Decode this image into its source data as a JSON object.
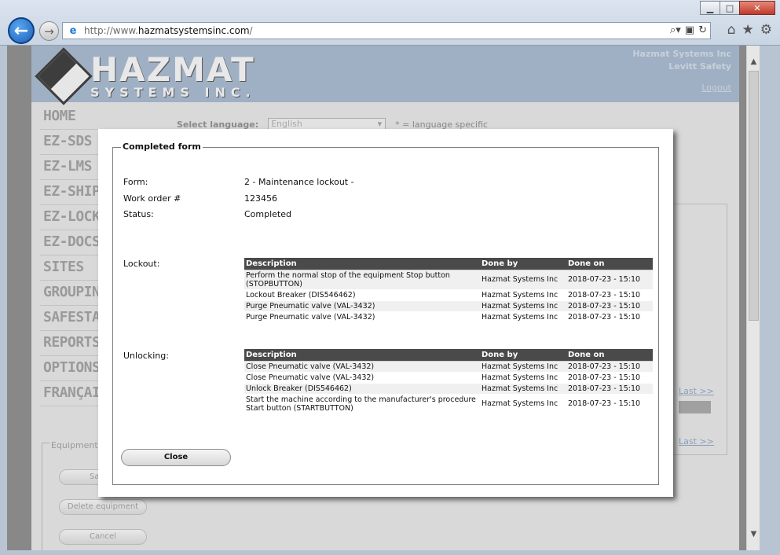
{
  "browser": {
    "url_prefix": "http://www.",
    "url_host": "hazmatsystemsinc.com",
    "url_suffix": "/"
  },
  "site": {
    "logo_main": "HAZMAT",
    "logo_sub": "SYSTEMS INC.",
    "company_name": "Hazmat Systems Inc",
    "company_sub": "Levitt Safety",
    "logout": "Logout",
    "nav": [
      "HOME",
      "EZ-SDS",
      "EZ-LMS",
      "EZ-SHIP",
      "EZ-LOCKOUT",
      "EZ-DOCS",
      "SITES",
      "GROUPING",
      "SAFESTATION",
      "REPORTS",
      "OPTIONS",
      "FRANÇAIS"
    ],
    "select_language_label": "Select language:",
    "language_value": "English",
    "language_note": "* = language specific",
    "equipment_legend": "Equipment",
    "save_button": "Save e",
    "delete_button": "Delete equipment",
    "cancel_button": "Cancel",
    "last_link": "Last >>"
  },
  "modal": {
    "legend": "Completed form",
    "form_label": "Form:",
    "form_value": "2 - Maintenance lockout -",
    "work_order_label": "Work order #",
    "work_order_value": "123456",
    "status_label": "Status:",
    "status_value": "Completed",
    "lockout_label": "Lockout:",
    "unlocking_label": "Unlocking:",
    "columns": {
      "description": "Description",
      "done_by": "Done by",
      "done_on": "Done on"
    },
    "lockout_rows": [
      {
        "description": "Perform the normal stop of the equipment Stop button (STOPBUTTON)",
        "done_by": "Hazmat Systems Inc",
        "done_on": "2018-07-23 - 15:10"
      },
      {
        "description": "Lockout Breaker (DIS546462)",
        "done_by": "Hazmat Systems Inc",
        "done_on": "2018-07-23 - 15:10"
      },
      {
        "description": "Purge Pneumatic valve (VAL-3432)",
        "done_by": "Hazmat Systems Inc",
        "done_on": "2018-07-23 - 15:10"
      },
      {
        "description": "Purge Pneumatic valve (VAL-3432)",
        "done_by": "Hazmat Systems Inc",
        "done_on": "2018-07-23 - 15:10"
      }
    ],
    "unlocking_rows": [
      {
        "description": "Close Pneumatic valve (VAL-3432)",
        "done_by": "Hazmat Systems Inc",
        "done_on": "2018-07-23 - 15:10"
      },
      {
        "description": "Close Pneumatic valve (VAL-3432)",
        "done_by": "Hazmat Systems Inc",
        "done_on": "2018-07-23 - 15:10"
      },
      {
        "description": "Unlock Breaker (DIS546462)",
        "done_by": "Hazmat Systems Inc",
        "done_on": "2018-07-23 - 15:10"
      },
      {
        "description": "Start the machine according to the manufacturer's procedure Start button (STARTBUTTON)",
        "done_by": "Hazmat Systems Inc",
        "done_on": "2018-07-23 - 15:10"
      }
    ],
    "close_button": "Close"
  }
}
